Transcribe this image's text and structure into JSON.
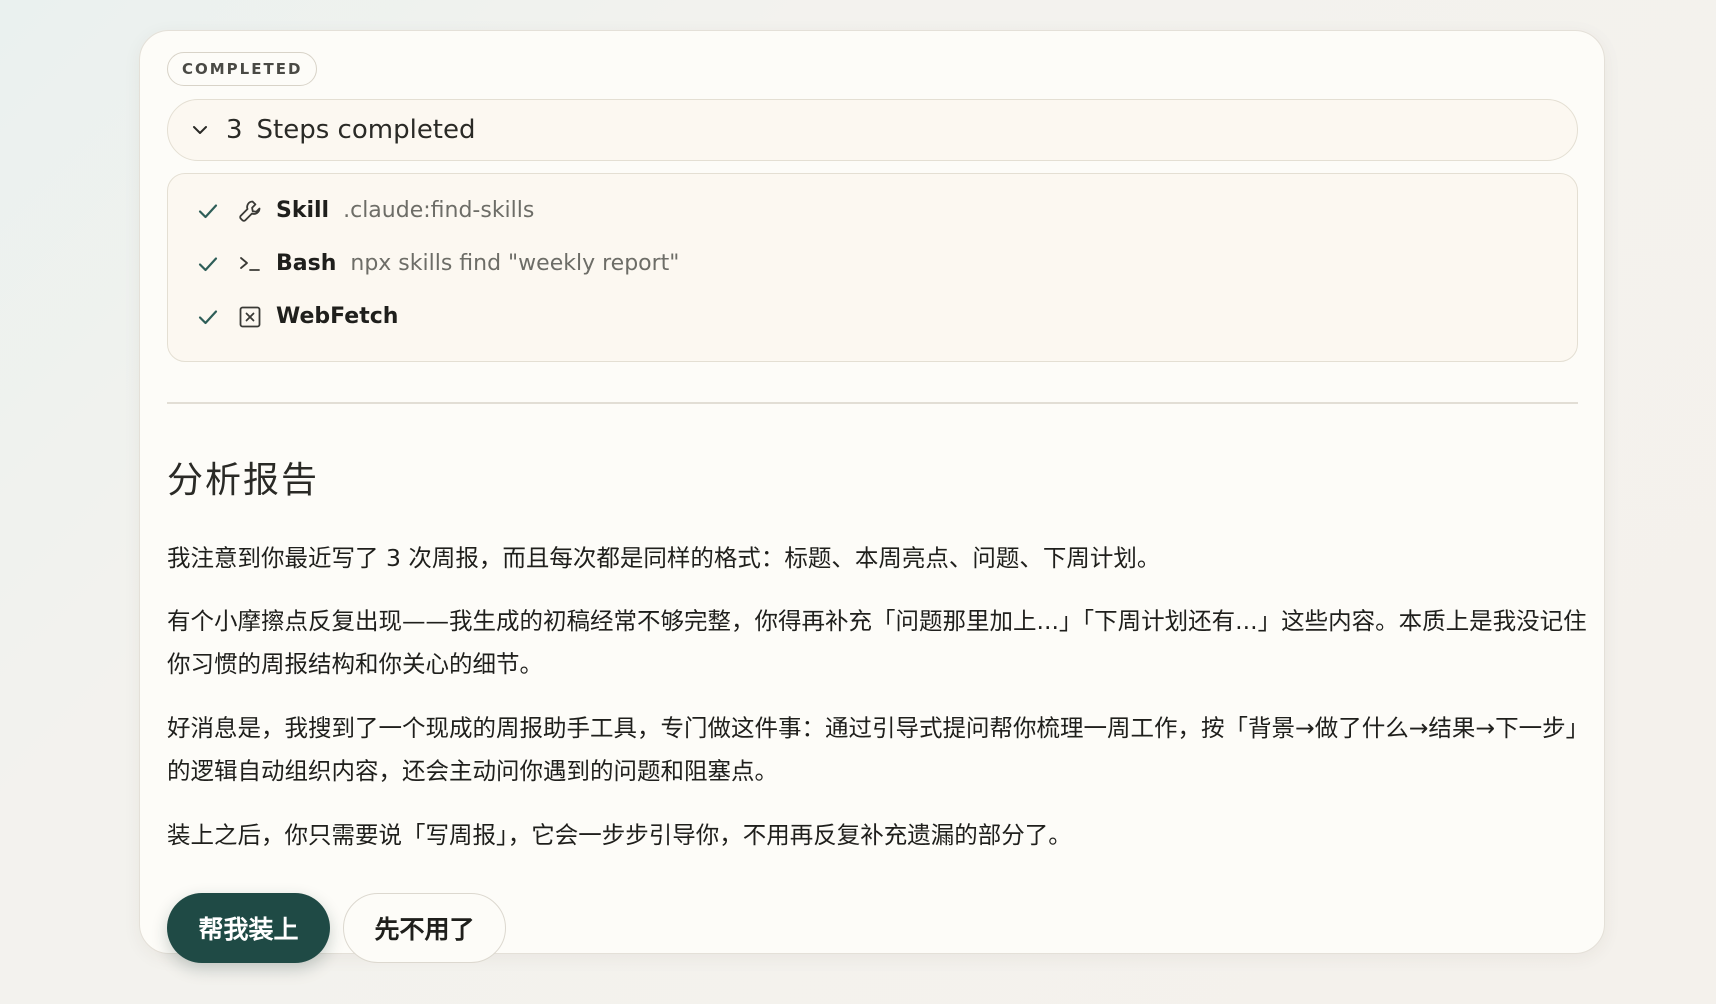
{
  "status_badge": "COMPLETED",
  "steps": {
    "count": "3",
    "label": "Steps completed",
    "items": [
      {
        "tool": "Skill",
        "arg": ".claude:find-skills",
        "icon": "wrench-icon"
      },
      {
        "tool": "Bash",
        "arg": "npx skills find \"weekly report\"",
        "icon": "terminal-icon"
      },
      {
        "tool": "WebFetch",
        "arg": "",
        "icon": "webfetch-box-icon"
      }
    ]
  },
  "report": {
    "title": "分析报告",
    "paragraphs": [
      "我注意到你最近写了 3 次周报，而且每次都是同样的格式：标题、本周亮点、问题、下周计划。",
      "有个小摩擦点反复出现——我生成的初稿经常不够完整，你得再补充「问题那里加上...」「下周计划还有...」这些内容。本质上是我没记住你习惯的周报结构和你关心的细节。",
      "好消息是，我搜到了一个现成的周报助手工具，专门做这件事：通过引导式提问帮你梳理一周工作，按「背景→做了什么→结果→下一步」的逻辑自动组织内容，还会主动问你遇到的问题和阻塞点。",
      "装上之后，你只需要说「写周报」，它会一步步引导你，不用再反复补充遗漏的部分了。"
    ]
  },
  "actions": {
    "install_label": "帮我装上",
    "decline_label": "先不用了"
  },
  "colors": {
    "accent": "#1f4a45",
    "check": "#2e5e58",
    "card_bg": "#fdfcf8",
    "panel_bg": "#fcf8f1"
  }
}
